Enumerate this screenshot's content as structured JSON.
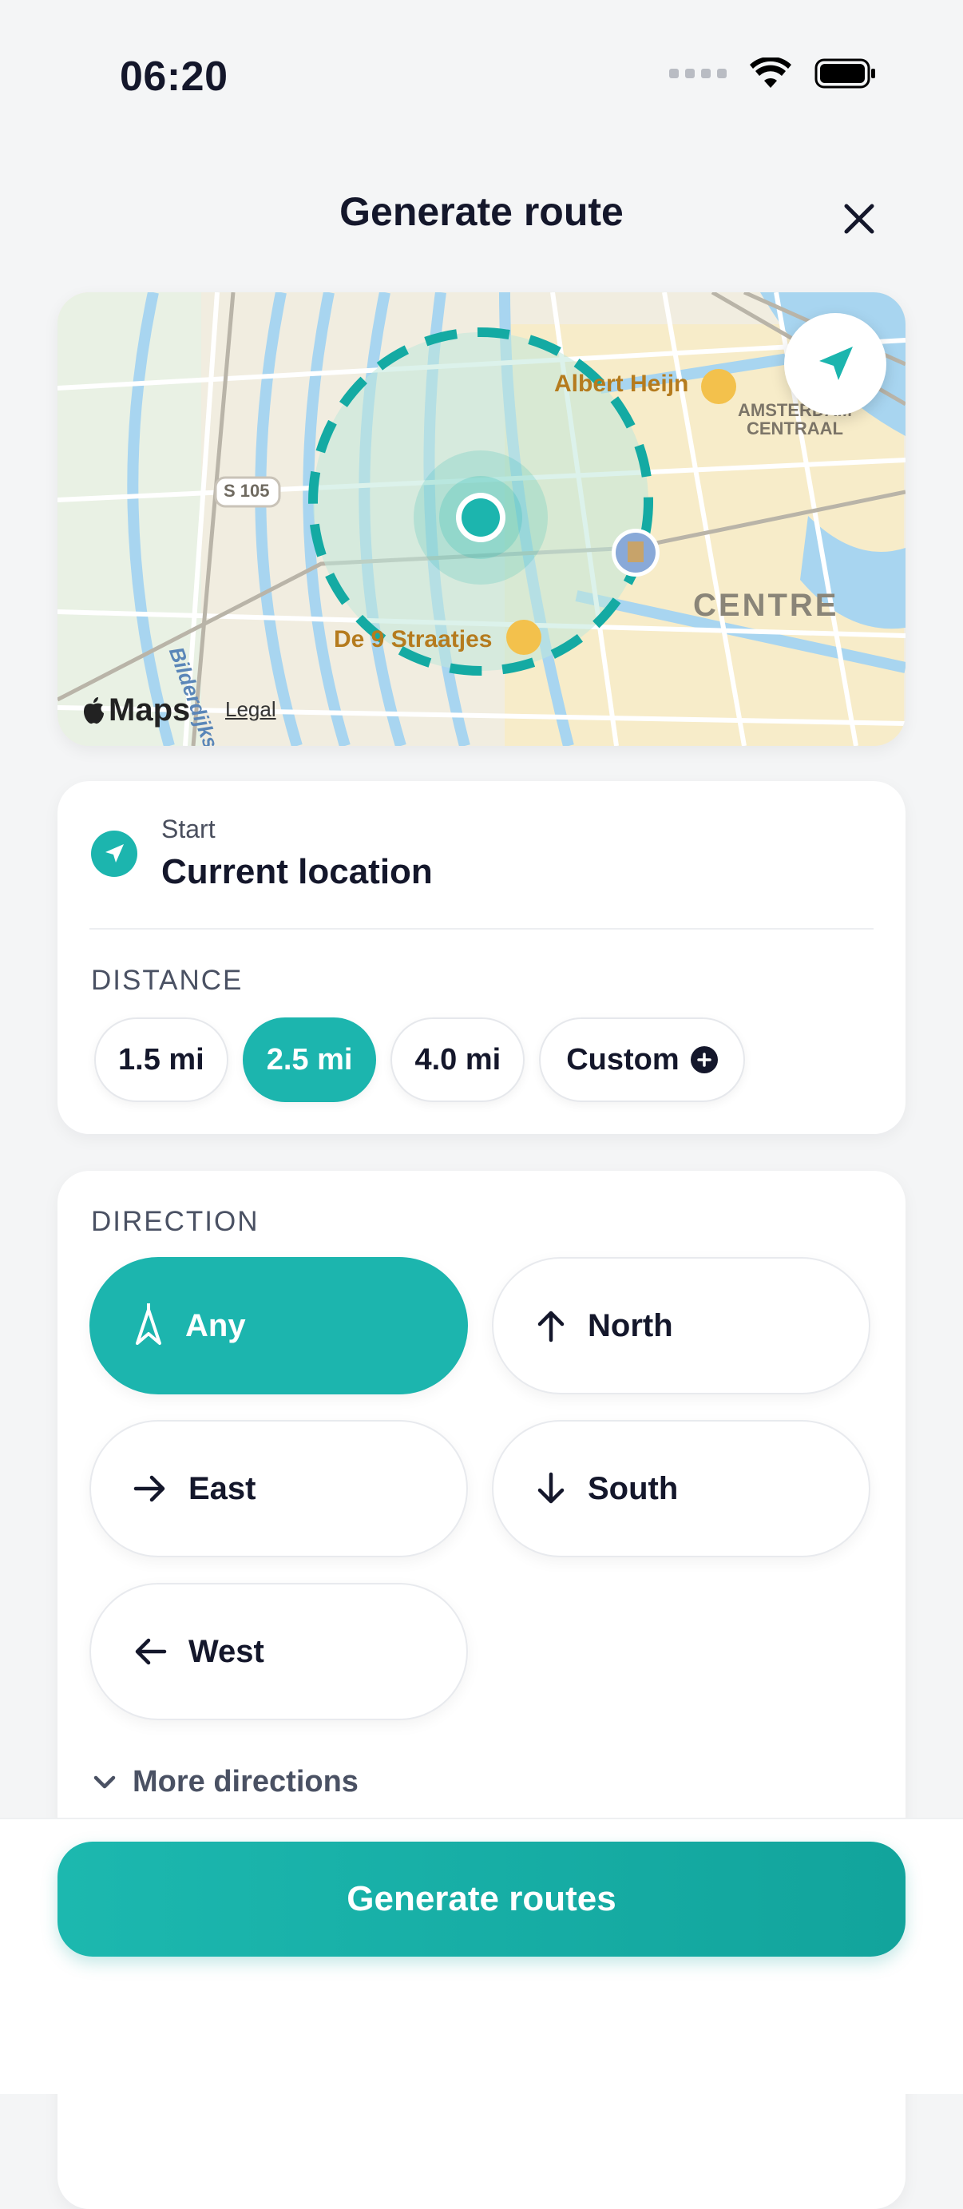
{
  "status": {
    "time": "06:20"
  },
  "header": {
    "title": "Generate route"
  },
  "map": {
    "labels": {
      "albert_heijn": "Albert Heijn",
      "amsterdam_centraal": "AMSTERDAM\nCENTRAAL",
      "centre": "CENTRE",
      "straatjes": "De 9 Straatjes",
      "road": "S 105",
      "street": "Bilderdijkstraat"
    },
    "attribution": {
      "maps": "Maps",
      "legal": "Legal"
    }
  },
  "start": {
    "label": "Start",
    "value": "Current location"
  },
  "distance": {
    "label": "DISTANCE",
    "options": [
      "1.5 mi",
      "2.5 mi",
      "4.0 mi"
    ],
    "custom_label": "Custom",
    "selected": "2.5 mi"
  },
  "direction": {
    "label": "DIRECTION",
    "options": [
      {
        "label": "Any",
        "icon": "compass-icon"
      },
      {
        "label": "North",
        "icon": "arrow-up-icon"
      },
      {
        "label": "East",
        "icon": "arrow-right-icon"
      },
      {
        "label": "South",
        "icon": "arrow-down-icon"
      },
      {
        "label": "West",
        "icon": "arrow-left-icon"
      }
    ],
    "selected": "Any",
    "more_label": "More directions"
  },
  "footer": {
    "button_label": "Generate routes"
  },
  "colors": {
    "accent": "#1CB5AE",
    "text": "#14172B"
  }
}
